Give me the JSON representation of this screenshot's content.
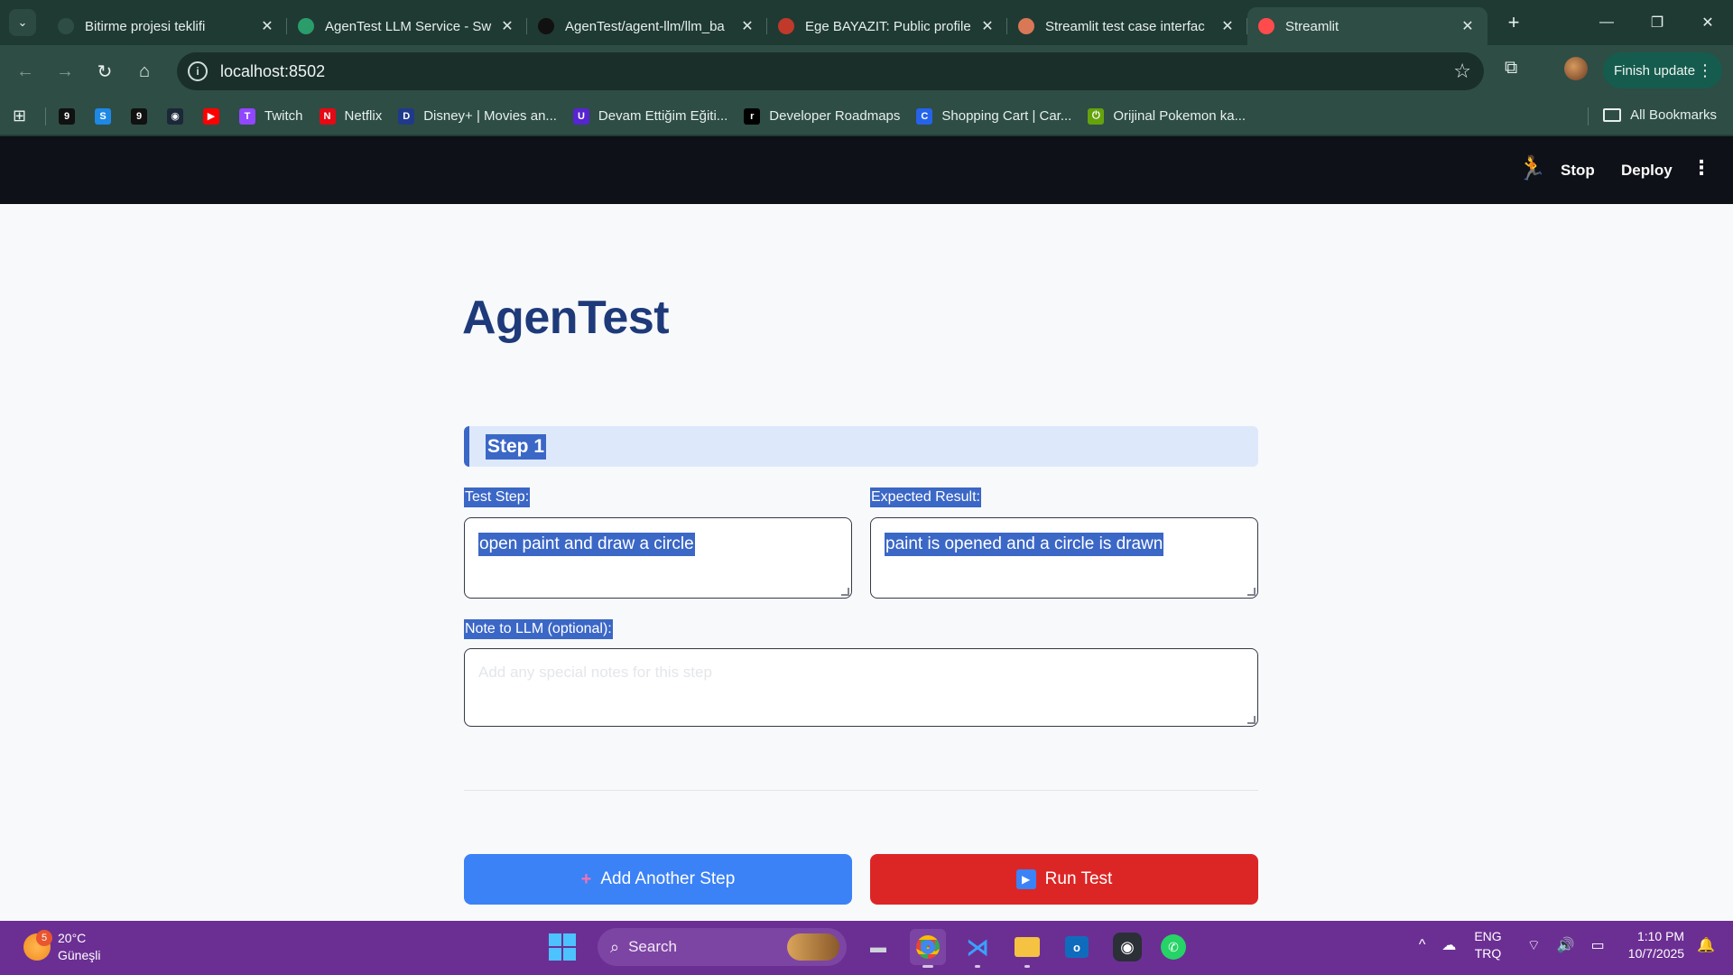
{
  "browser": {
    "tabs": [
      {
        "title": "Bitirme projesi teklifi",
        "icon": "openai-icon",
        "color": "#2e4d45"
      },
      {
        "title": "AgenTest LLM Service - Sw",
        "icon": "swagger-icon",
        "color": "#2a9d6a"
      },
      {
        "title": "AgenTest/agent-llm/llm_ba",
        "icon": "github-icon",
        "color": "#111111"
      },
      {
        "title": "Ege BAYAZIT: Public profile",
        "icon": "profile-icon",
        "color": "#c0392b"
      },
      {
        "title": "Streamlit test case interfac",
        "icon": "claude-icon",
        "color": "#d97757"
      },
      {
        "title": "Streamlit",
        "icon": "streamlit-icon",
        "color": "#ff4b4b"
      }
    ],
    "url": "localhost:8502",
    "finish_update": "Finish update",
    "bookmarks": [
      {
        "label": "",
        "icon": "app-9-icon",
        "color": "#111111",
        "glyph": "9"
      },
      {
        "label": "",
        "icon": "store-icon",
        "color": "#1e88e5",
        "glyph": "S"
      },
      {
        "label": "",
        "icon": "app-9b-icon",
        "color": "#111111",
        "glyph": "9"
      },
      {
        "label": "",
        "icon": "steam-icon",
        "color": "#1b2838",
        "glyph": "◉"
      },
      {
        "label": "",
        "icon": "youtube-icon",
        "color": "#ff0000",
        "glyph": "▶"
      },
      {
        "label": "Twitch",
        "icon": "twitch-icon",
        "color": "#9146ff",
        "glyph": "T"
      },
      {
        "label": "Netflix",
        "icon": "netflix-icon",
        "color": "#e50914",
        "glyph": "N"
      },
      {
        "label": "Disney+ | Movies an...",
        "icon": "disney-icon",
        "color": "#1f3a8a",
        "glyph": "D"
      },
      {
        "label": "Devam Ettiğim Eğiti...",
        "icon": "udemy-icon",
        "color": "#5624d0",
        "glyph": "U"
      },
      {
        "label": "Developer Roadmaps",
        "icon": "roadmap-icon",
        "color": "#000000",
        "glyph": "r"
      },
      {
        "label": "Shopping Cart | Car...",
        "icon": "cart-icon",
        "color": "#2563eb",
        "glyph": "C"
      },
      {
        "label": "Orijinal Pokemon ka...",
        "icon": "power-icon",
        "color": "#65a30d",
        "glyph": "⏻"
      }
    ],
    "all_bookmarks": "All Bookmarks"
  },
  "streamlit": {
    "stop_label": "Stop",
    "deploy_label": "Deploy"
  },
  "app": {
    "title": "AgenTest",
    "step_title": "Step 1",
    "test_step_label": "Test Step:",
    "test_step_value": "open paint and draw a circle",
    "expected_label": "Expected Result:",
    "expected_value": "paint is opened and a circle is drawn",
    "note_label": "Note to LLM (optional):",
    "note_placeholder": "Add any special notes for this step",
    "add_step_label": "Add Another Step",
    "run_test_label": "Run Test"
  },
  "taskbar": {
    "weather_badge": "5",
    "temperature": "20°C",
    "condition": "Güneşli",
    "search_label": "Search",
    "lang_top": "ENG",
    "lang_bottom": "TRQ",
    "time": "1:10 PM",
    "date": "10/7/2025"
  }
}
